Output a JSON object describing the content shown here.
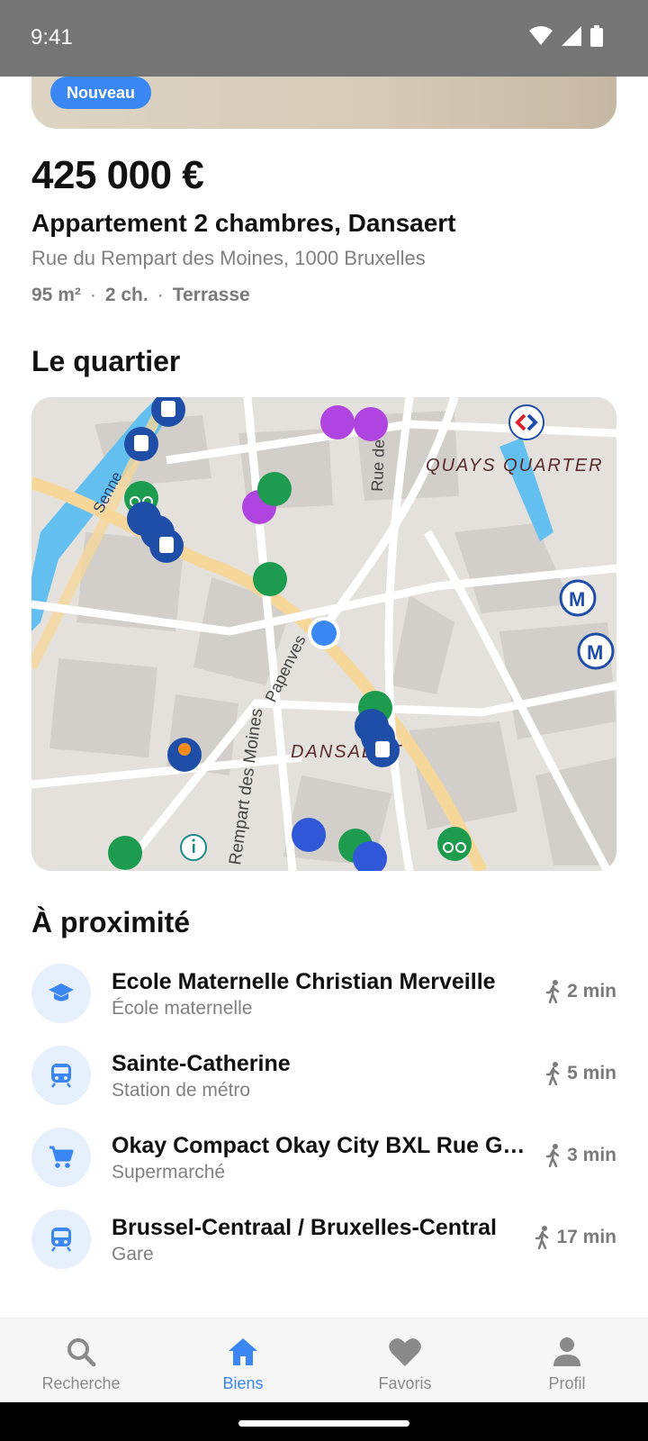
{
  "status_bar": {
    "time": "9:41"
  },
  "listing": {
    "badge": "Nouveau",
    "price": "425 000 €",
    "title": "Appartement 2 chambres, Dansaert",
    "address": "Rue du Rempart des Moines, 1000 Bruxelles",
    "specs": {
      "area": "95 m²",
      "rooms": "2 ch.",
      "feature": "Terrasse",
      "separator": "·"
    }
  },
  "neighborhood": {
    "title": "Le quartier",
    "map_labels": {
      "quays_quarter": "QUAYS QUARTER",
      "dansaert": "DANSAERT",
      "senne": "Senne",
      "rue_de": "Rue de",
      "rempart": "Rempart des Moines",
      "papenvest": "Papenves"
    }
  },
  "nearby": {
    "title": "À proximité",
    "items": [
      {
        "name": "Ecole Maternelle Christian Merveille",
        "category": "École maternelle",
        "time": "2 min",
        "icon": "school-icon"
      },
      {
        "name": "Sainte-Catherine",
        "category": "Station de métro",
        "time": "5 min",
        "icon": "metro-icon"
      },
      {
        "name": "Okay Compact Okay City BXL Rue Gr-...",
        "category": "Supermarché",
        "time": "3 min",
        "icon": "cart-icon"
      },
      {
        "name": "Brussel-Centraal / Bruxelles-Central",
        "category": "Gare",
        "time": "17 min",
        "icon": "train-icon"
      }
    ]
  },
  "tabbar": {
    "tabs": [
      {
        "label": "Recherche",
        "icon": "search-icon"
      },
      {
        "label": "Biens",
        "icon": "home-icon"
      },
      {
        "label": "Favoris",
        "icon": "heart-icon"
      },
      {
        "label": "Profil",
        "icon": "person-icon"
      }
    ],
    "active": "Biens"
  },
  "colors": {
    "accent": "#3a86f2",
    "status_bar": "#757575",
    "icon_bg": "#e6effc"
  }
}
